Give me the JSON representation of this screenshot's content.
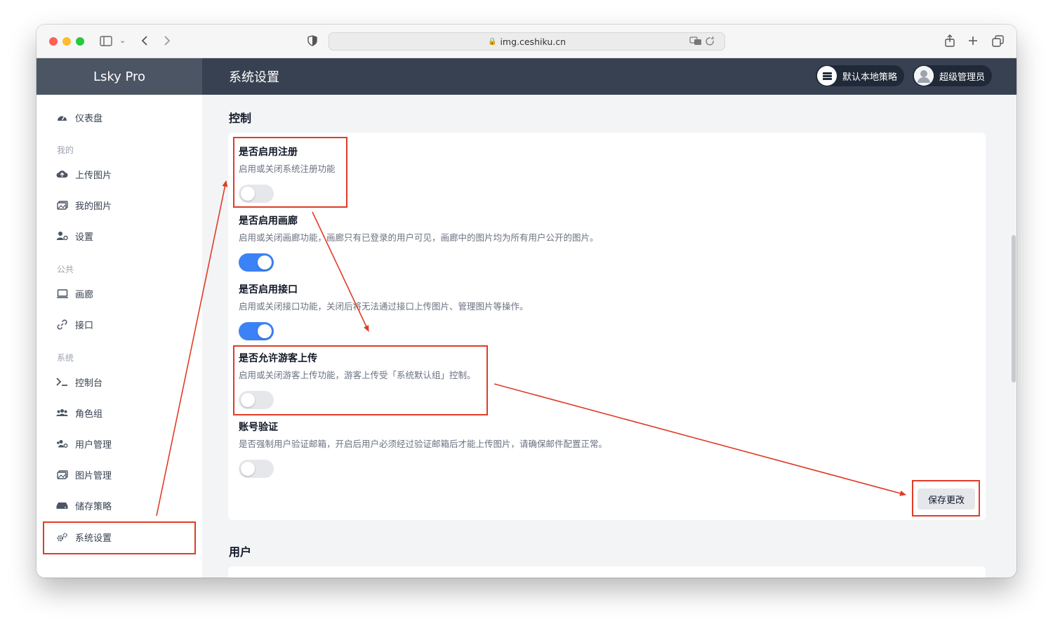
{
  "browser": {
    "url": "img.ceshiku.cn"
  },
  "app": {
    "brand": "Lsky Pro",
    "page_title": "系统设置"
  },
  "topbar": {
    "storage_label": "默认本地策略",
    "user_label": "超级管理员"
  },
  "sidebar": {
    "dashboard": "仪表盘",
    "group_mine": "我的",
    "upload": "上传图片",
    "my_images": "我的图片",
    "settings": "设置",
    "group_public": "公共",
    "gallery": "画廊",
    "api": "接口",
    "group_system": "系统",
    "console": "控制台",
    "roles": "角色组",
    "users": "用户管理",
    "images": "图片管理",
    "storage": "储存策略",
    "system_settings": "系统设置"
  },
  "control": {
    "section_title": "控制",
    "options": [
      {
        "title": "是否启用注册",
        "desc": "启用或关闭系统注册功能",
        "enabled": false
      },
      {
        "title": "是否启用画廊",
        "desc": "启用或关闭画廊功能，画廊只有已登录的用户可见，画廊中的图片均为所有用户公开的图片。",
        "enabled": true
      },
      {
        "title": "是否启用接口",
        "desc": "启用或关闭接口功能，关闭后将无法通过接口上传图片、管理图片等操作。",
        "enabled": true
      },
      {
        "title": "是否允许游客上传",
        "desc": "启用或关闭游客上传功能，游客上传受「系统默认组」控制。",
        "enabled": false
      },
      {
        "title": "账号验证",
        "desc": "是否强制用户验证邮箱，开启后用户必须经过验证邮箱后才能上传图片，请确保邮件配置正常。",
        "enabled": false
      }
    ],
    "save_label": "保存更改"
  },
  "users_section": {
    "title": "用户"
  },
  "annotation_color": "#e03c27"
}
